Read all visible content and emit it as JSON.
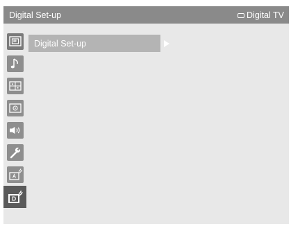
{
  "header": {
    "title": "Digital Set-up",
    "source_label": "Digital TV"
  },
  "sidebar": {
    "items": [
      {
        "icon": "picture-icon"
      },
      {
        "icon": "music-note-icon"
      },
      {
        "icon": "grid-icon"
      },
      {
        "icon": "film-icon"
      },
      {
        "icon": "speaker-icon"
      },
      {
        "icon": "wrench-icon"
      },
      {
        "icon": "analog-tv-icon"
      },
      {
        "icon": "digital-tv-icon",
        "selected": true
      }
    ]
  },
  "menu": {
    "items": [
      {
        "label": "Digital Set-up",
        "has_submenu": true
      }
    ]
  },
  "colors": {
    "titlebar": "#8a8a8a",
    "panel": "#e8e8e8",
    "highlight": "#b4b4b4",
    "selected_tab": "#5a5a5a",
    "text": "#ffffff"
  }
}
